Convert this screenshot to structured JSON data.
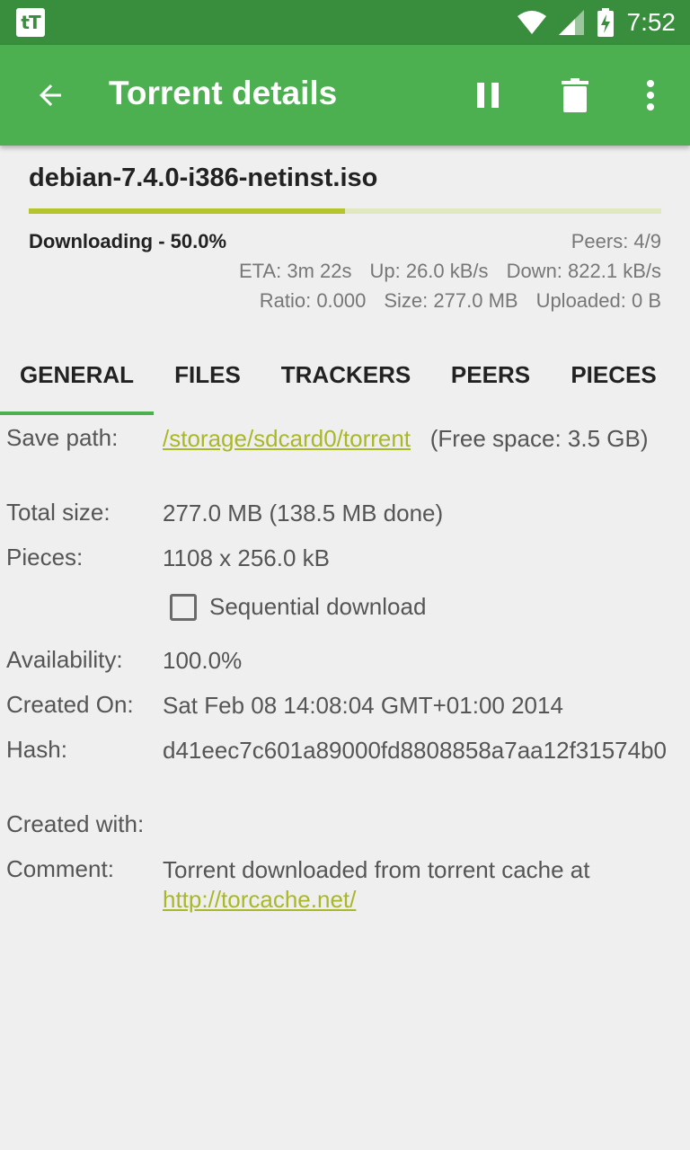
{
  "status_bar": {
    "time": "7:52",
    "app_badge": "tT"
  },
  "appbar": {
    "title": "Torrent details"
  },
  "torrent": {
    "name": "debian-7.4.0-i386-netinst.iso",
    "progress_fraction": 0.5,
    "status": "Downloading - 50.0%",
    "peers": "Peers: 4/9",
    "eta": "ETA: 3m 22s",
    "up": "Up: 26.0 kB/s",
    "down": "Down: 822.1 kB/s",
    "ratio": "Ratio: 0.000",
    "size": "Size: 277.0 MB",
    "uploaded": "Uploaded: 0 B"
  },
  "tabs": [
    "GENERAL",
    "FILES",
    "TRACKERS",
    "PEERS",
    "PIECES"
  ],
  "general": {
    "save_path_label": "Save path:",
    "save_path": "/storage/sdcard0/torrent",
    "free_space": "(Free space: 3.5 GB)",
    "total_size_label": "Total size:",
    "total_size": "277.0 MB (138.5 MB done)",
    "pieces_label": "Pieces:",
    "pieces": "1108 x 256.0 kB",
    "sequential_label": "Sequential download",
    "sequential_checked": false,
    "availability_label": "Availability:",
    "availability": "100.0%",
    "created_on_label": "Created On:",
    "created_on": "Sat Feb 08 14:08:04 GMT+01:00 2014",
    "hash_label": "Hash:",
    "hash": "d41eec7c601a89000fd8808858a7aa12f31574b0",
    "created_with_label": "Created with:",
    "comment_label": "Comment:",
    "comment_text": "Torrent downloaded from torrent cache at",
    "comment_link": "http://torcache.net/"
  },
  "colors": {
    "primary": "#4caf50",
    "primary_dark": "#388e3c",
    "accent": "#aab827"
  }
}
